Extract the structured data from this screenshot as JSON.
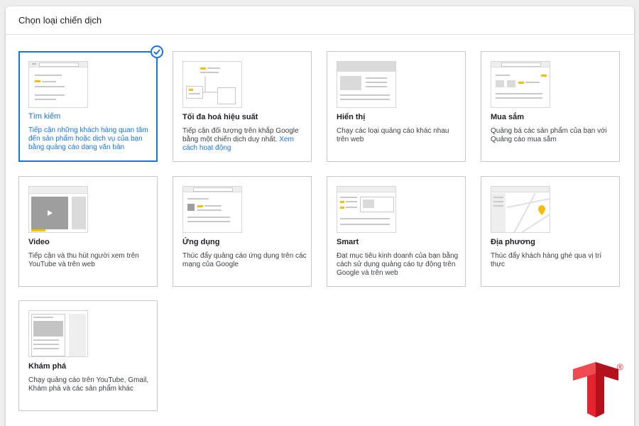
{
  "header": {
    "title": "Chọn loại chiến dịch"
  },
  "cards": [
    {
      "title": "Tìm kiếm",
      "desc": "Tiếp cận những khách hàng quan tâm đến sản phẩm hoặc dịch vụ của bạn bằng quảng cáo dạng văn bản",
      "selected": true
    },
    {
      "title": "Tối đa hoá hiệu suất",
      "desc": "Tiếp cận đối tượng trên khắp Google bằng một chiến dịch duy nhất.",
      "link": "Xem cách hoạt động"
    },
    {
      "title": "Hiển thị",
      "desc": "Chạy các loại quảng cáo khác nhau trên web"
    },
    {
      "title": "Mua sắm",
      "desc": "Quảng bá các sản phẩm của bạn với Quảng cáo mua sắm"
    },
    {
      "title": "Video",
      "desc": "Tiếp cận và thu hút người xem trên YouTube và trên web"
    },
    {
      "title": "Ứng dụng",
      "desc": "Thúc đẩy quảng cáo ứng dụng trên các mạng của Google"
    },
    {
      "title": "Smart",
      "desc": "Đạt mục tiêu kinh doanh của bạn bằng cách sử dụng quảng cáo tự động trên Google và trên web"
    },
    {
      "title": "Địa phương",
      "desc": "Thúc đẩy khách hàng ghé qua vị trí thực"
    },
    {
      "title": "Khám phá",
      "desc": "Chạy quảng cáo trên YouTube, Gmail, Khám phá và các sản phẩm khác"
    }
  ],
  "colors": {
    "accent": "#1a73e8",
    "highlight": "#fbbc04",
    "logo": "#e8222e"
  },
  "watermark": {
    "registered": "®"
  }
}
